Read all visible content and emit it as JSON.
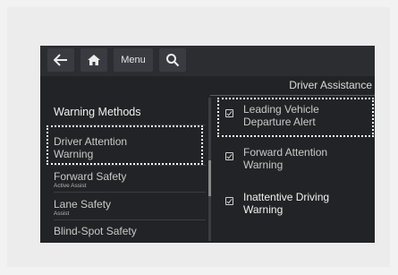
{
  "toolbar": {
    "back_icon": "arrow-left-icon",
    "home_icon": "home-icon",
    "menu_label": "Menu",
    "search_icon": "search-icon"
  },
  "header": {
    "title": "Driver Assistance"
  },
  "left_menu": {
    "heading": "Warning Methods",
    "items": [
      {
        "label": "Driver Attention Warning",
        "line1": "Driver Attention",
        "line2": "Warning",
        "sub": ""
      },
      {
        "label": "Forward Safety",
        "line1": "Forward Safety",
        "line2": "",
        "sub": "Active Assist"
      },
      {
        "label": "Lane Safety",
        "line1": "Lane Safety",
        "line2": "",
        "sub": "Assist"
      },
      {
        "label": "Blind-Spot Safety",
        "line1": "Blind-Spot Safety",
        "line2": "",
        "sub": ""
      }
    ]
  },
  "options": [
    {
      "line1": "Leading Vehicle",
      "line2": "Departure Alert",
      "checked": true
    },
    {
      "line1": "Forward Attention",
      "line2": "Warning",
      "checked": true
    },
    {
      "line1": "Inattentive Driving",
      "line2": "Warning",
      "checked": true
    }
  ],
  "colors": {
    "screen_bg": "#222326",
    "toolbar_bg": "#2c2d31",
    "focus_outline": "#ffffff",
    "text": "#c9c9c9"
  }
}
